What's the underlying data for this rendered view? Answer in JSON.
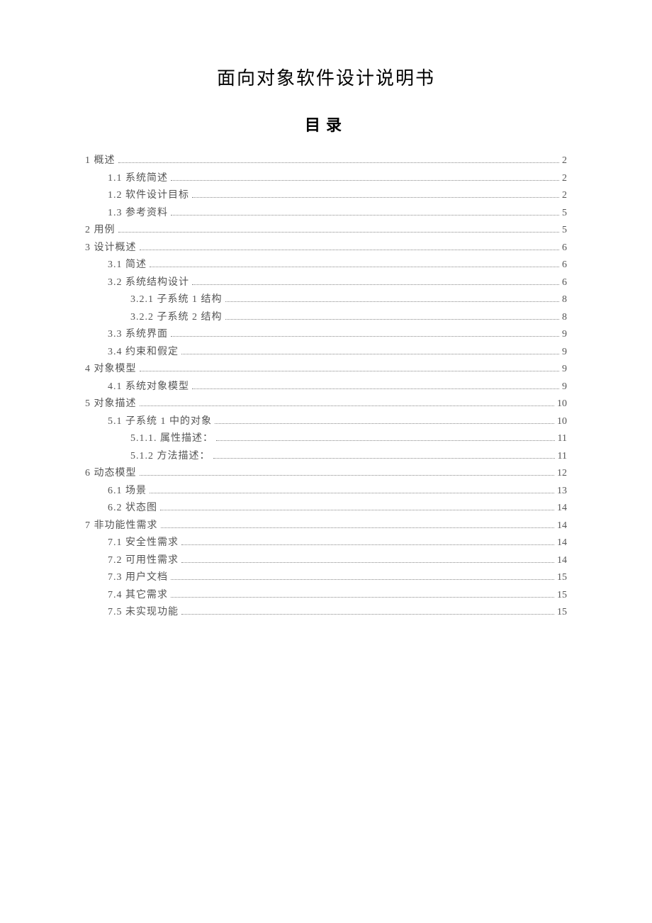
{
  "title": "面向对象软件设计说明书",
  "subtitle": "目录",
  "toc": [
    {
      "level": 1,
      "label": "1 概述",
      "page": "2"
    },
    {
      "level": 2,
      "label": "1.1 系统简述",
      "page": "2"
    },
    {
      "level": 2,
      "label": "1.2 软件设计目标",
      "page": "2"
    },
    {
      "level": 2,
      "label": "1.3 参考资料",
      "page": "5"
    },
    {
      "level": 1,
      "label": "2 用例",
      "page": "5"
    },
    {
      "level": 1,
      "label": "3 设计概述",
      "page": "6"
    },
    {
      "level": 2,
      "label": "3.1 简述",
      "page": "6"
    },
    {
      "level": 2,
      "label": "3.2 系统结构设计",
      "page": "6"
    },
    {
      "level": 3,
      "label": "3.2.1 子系统 1 结构",
      "page": "8"
    },
    {
      "level": 3,
      "label": "3.2.2 子系统 2 结构",
      "page": "8"
    },
    {
      "level": 2,
      "label": "3.3 系统界面",
      "page": "9"
    },
    {
      "level": 2,
      "label": "3.4 约束和假定",
      "page": "9"
    },
    {
      "level": 1,
      "label": "4 对象模型",
      "page": "9"
    },
    {
      "level": 2,
      "label": "4.1 系统对象模型",
      "page": "9"
    },
    {
      "level": 1,
      "label": "5 对象描述",
      "page": "10"
    },
    {
      "level": 2,
      "label": "5.1 子系统 1 中的对象",
      "page": "10"
    },
    {
      "level": 3,
      "label": "5.1.1. 属性描述：",
      "page": "11"
    },
    {
      "level": 3,
      "label": "5.1.2 方法描述：",
      "page": "11"
    },
    {
      "level": 1,
      "label": "6 动态模型",
      "page": "12"
    },
    {
      "level": 2,
      "label": "6.1 场景",
      "page": "13"
    },
    {
      "level": 2,
      "label": "6.2 状态图",
      "page": "14"
    },
    {
      "level": 1,
      "label": "7 非功能性需求",
      "page": "14"
    },
    {
      "level": 2,
      "label": "7.1 安全性需求",
      "page": "14"
    },
    {
      "level": 2,
      "label": "7.2 可用性需求",
      "page": "14"
    },
    {
      "level": 2,
      "label": "7.3 用户文档",
      "page": "15"
    },
    {
      "level": 2,
      "label": "7.4 其它需求",
      "page": "15"
    },
    {
      "level": 2,
      "label": "7.5 未实现功能",
      "page": "15"
    }
  ]
}
